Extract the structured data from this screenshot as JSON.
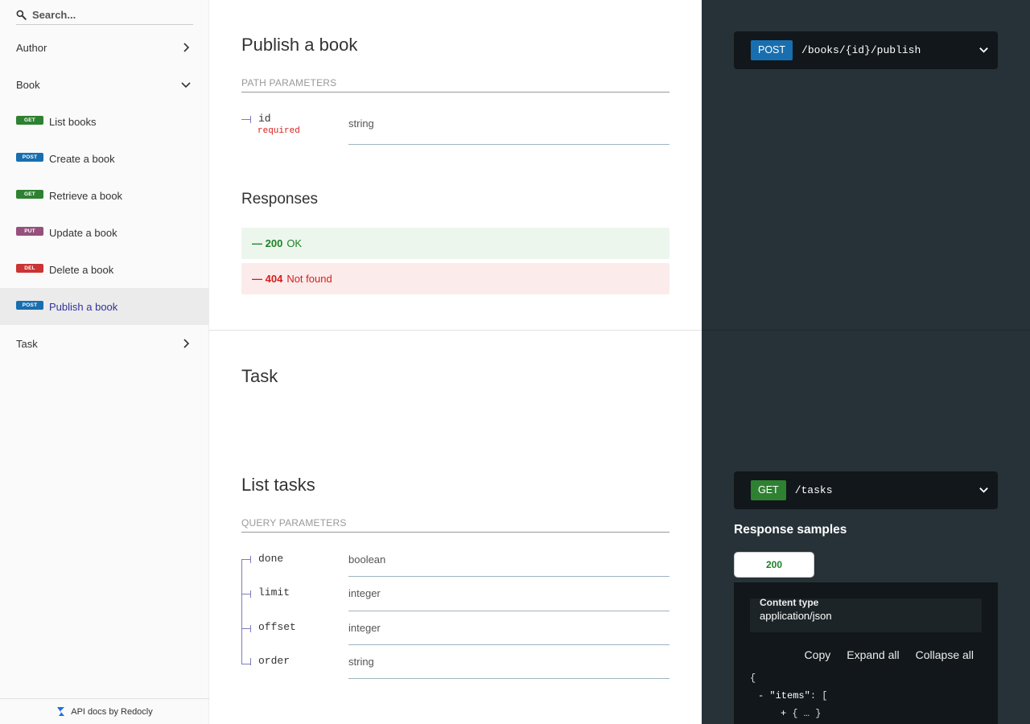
{
  "search": {
    "placeholder": "Search..."
  },
  "sidebar": {
    "groups": [
      {
        "label": "Author"
      },
      {
        "label": "Book"
      }
    ],
    "book_items": [
      {
        "method": "GET",
        "label": "List books"
      },
      {
        "method": "POST",
        "label": "Create a book"
      },
      {
        "method": "GET",
        "label": "Retrieve a book"
      },
      {
        "method": "PUT",
        "label": "Update a book"
      },
      {
        "method": "DEL",
        "label": "Delete a book"
      },
      {
        "method": "POST",
        "label": "Publish a book"
      }
    ],
    "task_group": {
      "label": "Task"
    },
    "footer": "API docs by Redocly"
  },
  "publish": {
    "title": "Publish a book",
    "path_params_label": "PATH PARAMETERS",
    "param": {
      "name": "id",
      "required": "required",
      "type": "string"
    },
    "responses_title": "Responses",
    "responses": [
      {
        "code": "— 200",
        "text": "OK"
      },
      {
        "code": "— 404",
        "text": "Not found"
      }
    ],
    "endpoint": {
      "method": "POST",
      "path": "/books/{id}/publish"
    }
  },
  "task_section": {
    "title": "Task"
  },
  "list_tasks": {
    "title": "List tasks",
    "query_params_label": "QUERY PARAMETERS",
    "params": [
      {
        "name": "done",
        "type": "boolean"
      },
      {
        "name": "limit",
        "type": "integer"
      },
      {
        "name": "offset",
        "type": "integer"
      },
      {
        "name": "order",
        "type": "string"
      }
    ],
    "endpoint": {
      "method": "GET",
      "path": "/tasks"
    },
    "samples_title": "Response samples",
    "sample_tab": "200",
    "content_type_label": "Content type",
    "content_type_value": "application/json",
    "controls": {
      "copy": "Copy",
      "expand": "Expand all",
      "collapse": "Collapse all"
    },
    "code": {
      "open": "{",
      "items_toggle": "-",
      "items_key": "\"items\"",
      "items_rest": ": [",
      "nested_toggle": "+",
      "nested": "{ … }"
    }
  },
  "colors": {
    "get": "#2f8132",
    "post": "#186faf",
    "put": "#95507c",
    "delete": "#cc3333",
    "active_text": "#32329f",
    "right_panel": "#263238"
  }
}
